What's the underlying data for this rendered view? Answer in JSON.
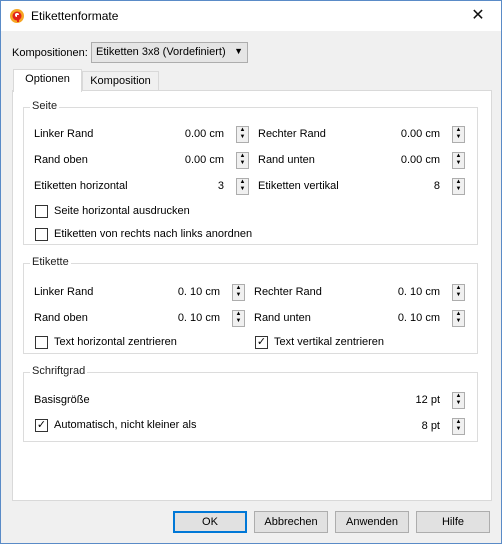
{
  "window": {
    "title": "Etikettenformate",
    "accent": "#0078d7"
  },
  "compositions": {
    "label": "Kompositionen:",
    "selected": "Etiketten 3x8 (Vordefiniert)"
  },
  "tabs": [
    {
      "label": "Optionen",
      "active": true
    },
    {
      "label": "Komposition",
      "active": false
    }
  ],
  "seite": {
    "title": "Seite",
    "left_margin": {
      "label": "Linker Rand",
      "value": "0.00 cm"
    },
    "right_margin": {
      "label": "Rechter Rand",
      "value": "0.00 cm"
    },
    "top_margin": {
      "label": "Rand oben",
      "value": "0.00 cm"
    },
    "bottom_margin": {
      "label": "Rand unten",
      "value": "0.00 cm"
    },
    "labels_horizontal": {
      "label": "Etiketten horizontal",
      "value": "3"
    },
    "labels_vertical": {
      "label": "Etiketten vertikal",
      "value": "8"
    },
    "print_horizontal": {
      "label": "Seite horizontal ausdrucken",
      "checked": false
    },
    "right_to_left": {
      "label": "Etiketten von rechts nach links anordnen",
      "checked": false
    }
  },
  "etikette": {
    "title": "Etikette",
    "left_margin": {
      "label": "Linker Rand",
      "value": "0. 10 cm"
    },
    "right_margin": {
      "label": "Rechter Rand",
      "value": "0. 10 cm"
    },
    "top_margin": {
      "label": "Rand oben",
      "value": "0. 10 cm"
    },
    "bottom_margin": {
      "label": "Rand unten",
      "value": "0. 10 cm"
    },
    "center_horizontal": {
      "label": "Text horizontal zentrieren",
      "checked": false
    },
    "center_vertical": {
      "label": "Text vertikal zentrieren",
      "checked": true
    }
  },
  "schriftgrad": {
    "title": "Schriftgrad",
    "base_size": {
      "label": "Basisgröße",
      "value": "12 pt"
    },
    "auto": {
      "label": "Automatisch, nicht kleiner als",
      "checked": true,
      "value": "8 pt"
    }
  },
  "buttons": {
    "ok": "OK",
    "cancel": "Abbrechen",
    "apply": "Anwenden",
    "help": "Hilfe"
  },
  "icons": {
    "app": "app-logo-icon",
    "close": "close-icon",
    "spin": "spin-arrows-icon",
    "check": "checkmark-icon"
  }
}
